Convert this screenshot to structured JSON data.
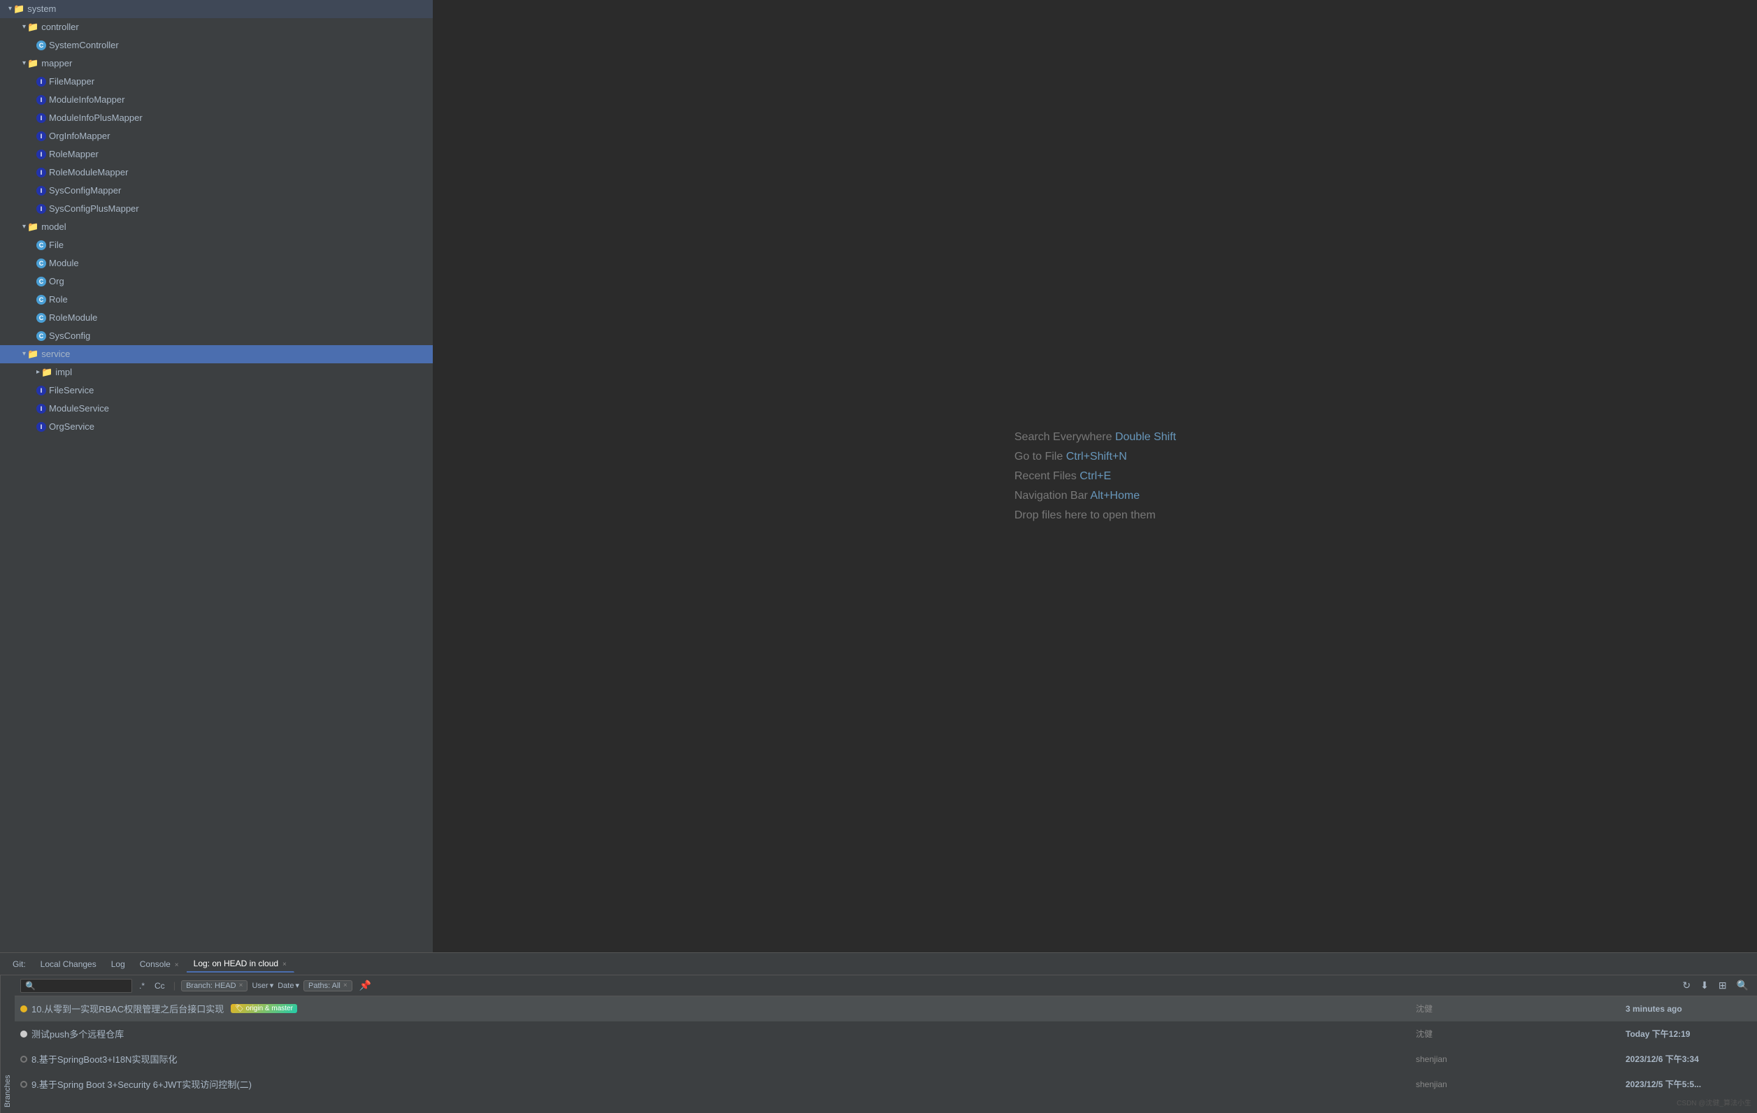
{
  "sidebar": {
    "items": [
      {
        "id": "system",
        "label": "system",
        "level": 0,
        "type": "folder",
        "expanded": true,
        "selected": false
      },
      {
        "id": "controller",
        "label": "controller",
        "level": 1,
        "type": "folder",
        "expanded": true,
        "selected": false
      },
      {
        "id": "SystemController",
        "label": "SystemController",
        "level": 2,
        "type": "class-blue",
        "selected": false
      },
      {
        "id": "mapper",
        "label": "mapper",
        "level": 1,
        "type": "folder",
        "expanded": true,
        "selected": false
      },
      {
        "id": "FileMapper",
        "label": "FileMapper",
        "level": 2,
        "type": "interface",
        "selected": false
      },
      {
        "id": "ModuleInfoMapper",
        "label": "ModuleInfoMapper",
        "level": 2,
        "type": "interface",
        "selected": false
      },
      {
        "id": "ModuleInfoPlusMapper",
        "label": "ModuleInfoPlusMapper",
        "level": 2,
        "type": "interface",
        "selected": false
      },
      {
        "id": "OrgInfoMapper",
        "label": "OrgInfoMapper",
        "level": 2,
        "type": "interface",
        "selected": false
      },
      {
        "id": "RoleMapper",
        "label": "RoleMapper",
        "level": 2,
        "type": "interface",
        "selected": false
      },
      {
        "id": "RoleModuleMapper",
        "label": "RoleModuleMapper",
        "level": 2,
        "type": "interface",
        "selected": false
      },
      {
        "id": "SysConfigMapper",
        "label": "SysConfigMapper",
        "level": 2,
        "type": "interface",
        "selected": false
      },
      {
        "id": "SysConfigPlusMapper",
        "label": "SysConfigPlusMapper",
        "level": 2,
        "type": "interface",
        "selected": false
      },
      {
        "id": "model",
        "label": "model",
        "level": 1,
        "type": "folder",
        "expanded": true,
        "selected": false
      },
      {
        "id": "File",
        "label": "File",
        "level": 2,
        "type": "class-blue",
        "selected": false
      },
      {
        "id": "Module",
        "label": "Module",
        "level": 2,
        "type": "class-blue",
        "selected": false
      },
      {
        "id": "Org",
        "label": "Org",
        "level": 2,
        "type": "class-blue",
        "selected": false
      },
      {
        "id": "Role",
        "label": "Role",
        "level": 2,
        "type": "class-blue",
        "selected": false
      },
      {
        "id": "RoleModule",
        "label": "RoleModule",
        "level": 2,
        "type": "class-blue",
        "selected": false
      },
      {
        "id": "SysConfig",
        "label": "SysConfig",
        "level": 2,
        "type": "class-blue",
        "selected": false
      },
      {
        "id": "service",
        "label": "service",
        "level": 1,
        "type": "folder",
        "expanded": true,
        "selected": true
      },
      {
        "id": "impl",
        "label": "impl",
        "level": 2,
        "type": "folder",
        "expanded": false,
        "selected": false
      },
      {
        "id": "FileService",
        "label": "FileService",
        "level": 2,
        "type": "interface",
        "selected": false
      },
      {
        "id": "ModuleService",
        "label": "ModuleService",
        "level": 2,
        "type": "interface",
        "selected": false
      },
      {
        "id": "OrgService",
        "label": "OrgService",
        "level": 2,
        "type": "interface",
        "selected": false
      }
    ]
  },
  "editor": {
    "hints": [
      {
        "text": "Search Everywhere",
        "shortcut": "Double Shift"
      },
      {
        "text": "Go to File",
        "shortcut": "Ctrl+Shift+N"
      },
      {
        "text": "Recent Files",
        "shortcut": "Ctrl+E"
      },
      {
        "text": "Navigation Bar",
        "shortcut": "Alt+Home"
      },
      {
        "text": "Drop files here to open them",
        "shortcut": ""
      }
    ]
  },
  "bottom_panel": {
    "tabs": [
      {
        "label": "Git:",
        "active": false,
        "closeable": false
      },
      {
        "label": "Local Changes",
        "active": false,
        "closeable": false
      },
      {
        "label": "Log",
        "active": false,
        "closeable": false
      },
      {
        "label": "Console",
        "active": false,
        "closeable": true
      },
      {
        "label": "Log: on HEAD in cloud",
        "active": true,
        "closeable": true
      }
    ],
    "toolbar": {
      "search_placeholder": "🔍",
      "regex_btn": ".*",
      "case_btn": "Cc",
      "branch_filter": "Branch: HEAD",
      "user_filter": "User",
      "date_filter": "Date",
      "paths_filter": "Paths: All",
      "branch_filter_close": "×",
      "user_filter_close": "",
      "date_filter_close": "",
      "paths_filter_close": "×"
    },
    "commits": [
      {
        "id": 1,
        "message": "10.从零到一实现RBAC权限管理之后台接口实现",
        "branch_tags": [
          "origin & master"
        ],
        "author": "沈健",
        "time": "3 minutes ago",
        "active": true,
        "bullet": "yellow"
      },
      {
        "id": 2,
        "message": "测试push多个远程仓库",
        "branch_tags": [],
        "author": "沈健",
        "time": "Today 下午12:19",
        "active": false,
        "bullet": "white"
      },
      {
        "id": 3,
        "message": "8.基于SpringBoot3+I18N实现国际化",
        "branch_tags": [],
        "author": "shenjian",
        "time": "2023/12/6 下午3:34",
        "active": false,
        "bullet": "gray"
      },
      {
        "id": 4,
        "message": "9.基于Spring Boot 3+Security 6+JWT实现访问控制(二)",
        "branch_tags": [],
        "author": "shenjian",
        "time": "2023/12/5 下午5:5...",
        "active": false,
        "bullet": "gray"
      }
    ],
    "branches_label": "Branches"
  },
  "watermark": "CSDN @沈健_算法小生"
}
